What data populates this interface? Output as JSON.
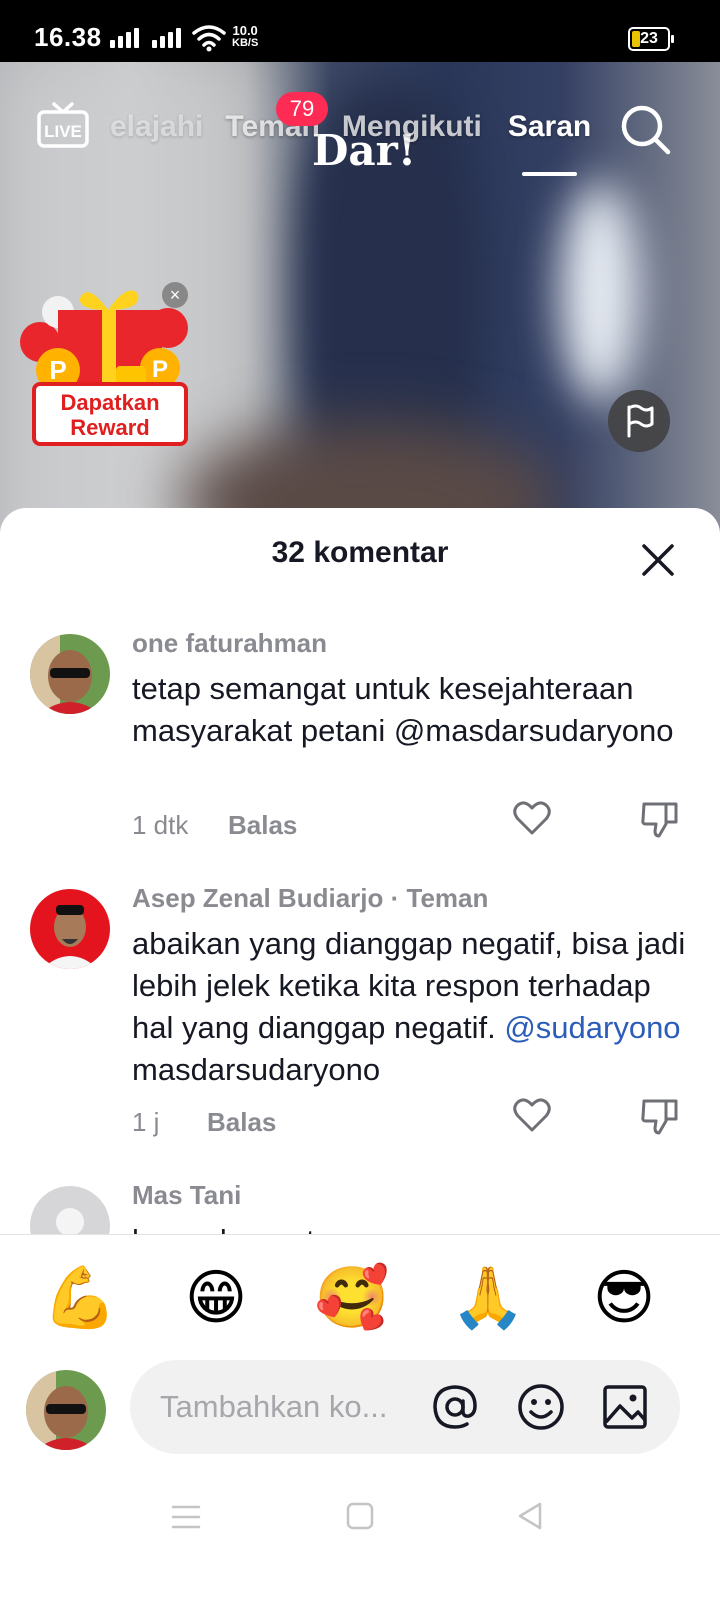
{
  "status_bar": {
    "time": "16.38",
    "net_speed_value": "10.0",
    "net_speed_unit": "KB/S",
    "battery": "23",
    "battery_color": "#e6c200"
  },
  "top_nav": {
    "live_label": "LIVE",
    "tabs": [
      {
        "label": "elajahi"
      },
      {
        "label": "Teman"
      },
      {
        "label": "Mengikuti"
      },
      {
        "label": "Saran"
      }
    ],
    "active_tab": "Saran",
    "friends_badge": "79",
    "video_text": "Dar!",
    "search_icon": "search-icon"
  },
  "reward": {
    "label_line1": "Dapatkan",
    "label_line2": "Reward",
    "close": "×"
  },
  "sheet": {
    "title": "32 komentar",
    "close_icon": "close-icon"
  },
  "comments": [
    {
      "user": "one faturahman",
      "text": "tetap semangat untuk kesejahteraan masyarakat petani @masdarsudaryono",
      "time": "1 dtk",
      "reply_label": "Balas"
    },
    {
      "user": "Asep Zenal Budiarjo",
      "relation": "· Teman",
      "text_before": "abaikan yang dianggap negatif, bisa jadi lebih jelek ketika kita respon terhadap hal yang dianggap negatif. ",
      "mention": "@sudaryono",
      "text_after": " masdarsudaryono",
      "time": "1 j",
      "reply_label": "Balas"
    },
    {
      "user": "Mas Tani",
      "text": "bener banget mas"
    }
  ],
  "emoji_bar": [
    "💪",
    "😁",
    "🥰",
    "🙏",
    "😎"
  ],
  "input": {
    "placeholder": "Tambahkan ko..."
  },
  "colors": {
    "accent": "#fe2c55",
    "mention": "#2b5db9",
    "reward_red": "#e02020"
  }
}
